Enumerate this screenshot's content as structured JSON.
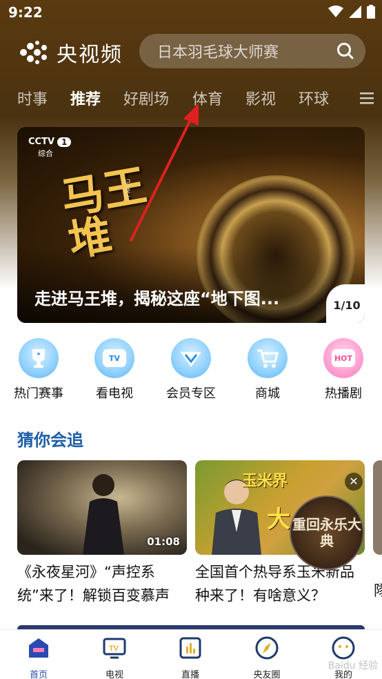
{
  "status_bar": {
    "time": "9:22"
  },
  "header": {
    "app_name": "央视频",
    "search_placeholder": "日本羽毛球大师赛"
  },
  "tabs": [
    {
      "label": "时事"
    },
    {
      "label": "推荐"
    },
    {
      "label": "好剧场"
    },
    {
      "label": "体育"
    },
    {
      "label": "影视"
    },
    {
      "label": "环球"
    }
  ],
  "active_tab": "推荐",
  "banner": {
    "channel_logo": "CCTV",
    "channel_number": "1",
    "channel_sub": "综合",
    "title_art": "马王堆",
    "doc_tag": "纪录片",
    "caption": "走进马王堆，揭秘这座“地下图...",
    "counter": "1/10"
  },
  "quick_entries": [
    {
      "label": "热门赛事",
      "icon": "trophy-icon"
    },
    {
      "label": "看电视",
      "icon": "tv-icon"
    },
    {
      "label": "会员专区",
      "icon": "vip-icon"
    },
    {
      "label": "商城",
      "icon": "cart-icon"
    },
    {
      "label": "热播剧",
      "icon": "hot-icon"
    }
  ],
  "section": {
    "title": "猜你会追"
  },
  "cards": [
    {
      "title": "《永夜星河》“声控系统”来了！解锁百变慕声",
      "duration": "01:08"
    },
    {
      "title": "全国首个热导系玉米新品种来了！有啥意义？",
      "badge": "玉米界",
      "badge2": "大"
    }
  ],
  "floating_promo": {
    "text": "重回永乐大典"
  },
  "peek_card": {
    "text": "隊"
  },
  "bottom_nav": [
    {
      "label": "首页"
    },
    {
      "label": "电视"
    },
    {
      "label": "直播"
    },
    {
      "label": "央友圈"
    },
    {
      "label": "我的"
    }
  ],
  "watermark": "Baidu 经验",
  "colors": {
    "accent": "#1d5fa8",
    "annotation_arrow": "#e02020",
    "header_bg": "#4a3210"
  }
}
